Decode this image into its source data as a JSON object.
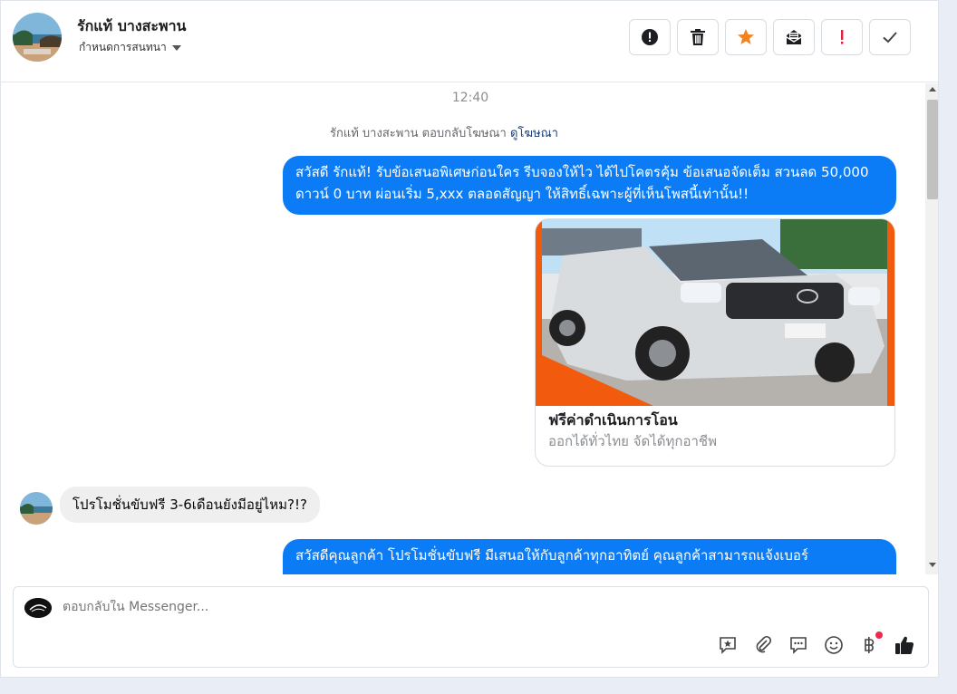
{
  "header": {
    "contact_name": "รักแท้ บางสะพาน",
    "assign_label": "กำหนดการสนทนา",
    "actions": [
      {
        "icon": "exclamation-circle-icon"
      },
      {
        "icon": "trash-icon"
      },
      {
        "icon": "star-icon"
      },
      {
        "icon": "mark-unread-icon"
      },
      {
        "icon": "exclamation-icon"
      },
      {
        "icon": "check-icon"
      }
    ]
  },
  "thread": {
    "timestamp": "12:40",
    "reply_note": "รักแท้ บางสะพาน ตอบกลับโฆษณา",
    "reply_link": "ดูโฆษณา",
    "messages": [
      {
        "from": "page",
        "text": "สวัสดี รักแท้! รับข้อเสนอพิเศษก่อนใคร รีบจองให้ไว ได้ไปโคตรคุ้ม ข้อเสนอจัดเต็ม สวนลด 50,000 ดาวน์ 0 บาท ผ่อนเริ่ม 5,xxx ตลอดสัญญา ให้สิทธิ์เฉพาะผู้ที่เห็นโพสนี้เท่านั้น!!"
      },
      {
        "from": "customer",
        "text": "โปรโมชั่นขับฟรี 3-6เดือนยังมีอยู่ไหม?!?"
      },
      {
        "from": "page",
        "text": "สวัสดีคุณลูกค้า โปรโมชั่นขับฟรี มีเสนอให้กับลูกค้าทุกอาทิตย์ คุณลูกค้าสามารถแจ้งเบอร์"
      }
    ],
    "ad_card": {
      "title": "ฟรีค่าดำเนินการโอน",
      "subtitle": "ออกได้ทั่วไทย จัดได้ทุกอาชีพ"
    }
  },
  "composer": {
    "placeholder": "ตอบกลับใน Messenger...",
    "tools": [
      "saved-reply-icon",
      "attach-icon",
      "chat-bubble-icon",
      "emoji-icon",
      "baht-payment-icon",
      "like-icon"
    ]
  },
  "colors": {
    "accent": "#0b7cf5",
    "orange": "#f25a0d",
    "incoming_bubble": "#efefef"
  }
}
